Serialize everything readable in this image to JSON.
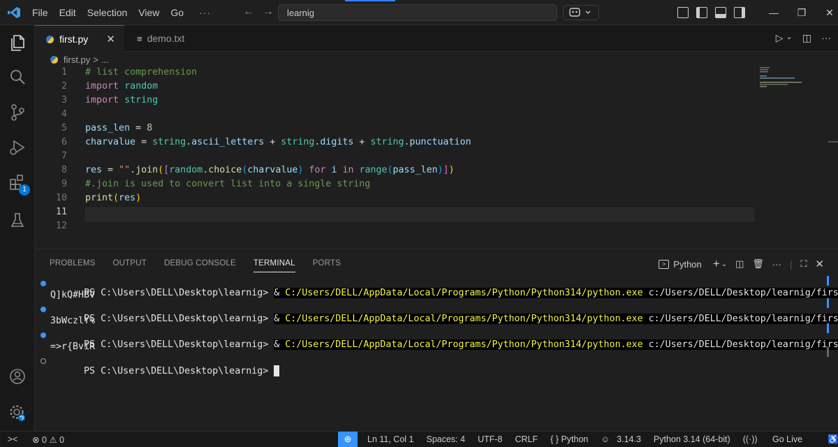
{
  "titlebar": {
    "menu": [
      "File",
      "Edit",
      "Selection",
      "View",
      "Go"
    ],
    "more": "···",
    "search_text": "learnig",
    "window_controls": [
      "—",
      "❐",
      "✕"
    ]
  },
  "activity": {
    "extensions_badge": "1"
  },
  "tabs": [
    {
      "label": "first.py",
      "active": true,
      "close": "✕"
    },
    {
      "label": "demo.txt",
      "active": false
    }
  ],
  "tab_actions": {
    "run": "▷",
    "chevron": "⌄",
    "split": "◫",
    "more": "···"
  },
  "breadcrumb": {
    "file": "first.py",
    "sep": ">",
    "rest": "..."
  },
  "editor": {
    "line_numbers": [
      "1",
      "2",
      "3",
      "4",
      "5",
      "6",
      "7",
      "8",
      "9",
      "10",
      "11",
      "12"
    ],
    "current_line": "11",
    "lines": [
      "# list comprehension",
      "import random",
      "import string",
      "",
      "pass_len = 8",
      "charvalue = string.ascii_letters + string.digits + string.punctuation",
      "",
      "res = \"\".join([random.choice(charvalue) for i in range(pass_len)])",
      "#.join is used to convert list into a single string",
      "print(res)",
      "",
      ""
    ]
  },
  "panel": {
    "tabs": [
      "PROBLEMS",
      "OUTPUT",
      "DEBUG CONSOLE",
      "TERMINAL",
      "PORTS"
    ],
    "active_tab": "TERMINAL",
    "terminal_profile": "Python",
    "terminal": {
      "prompt": "PS C:\\Users\\DELL\\Desktop\\learnig> ",
      "amp": "& ",
      "exe": "C:/Users/DELL/AppData/Local/Programs/Python/Python314/python.exe",
      "script": " c:/Users/DELL/Desktop/learnig/first.py",
      "outputs": [
        "Q]kQ#HBV",
        "3bWczlY%",
        "=>r{BviR"
      ]
    }
  },
  "statusbar": {
    "errors": "0",
    "warnings": "0",
    "position": "Ln 11, Col 1",
    "spaces": "Spaces: 4",
    "encoding": "UTF-8",
    "eol": "CRLF",
    "language": "{ } Python",
    "python_version": "3.14.3",
    "interpreter": "Python 3.14 (64-bit)",
    "golive": "Go Live"
  },
  "colors": {
    "accent": "#0078d4",
    "terminal_path": "#f5f543",
    "success_dot": "#3794ff"
  }
}
